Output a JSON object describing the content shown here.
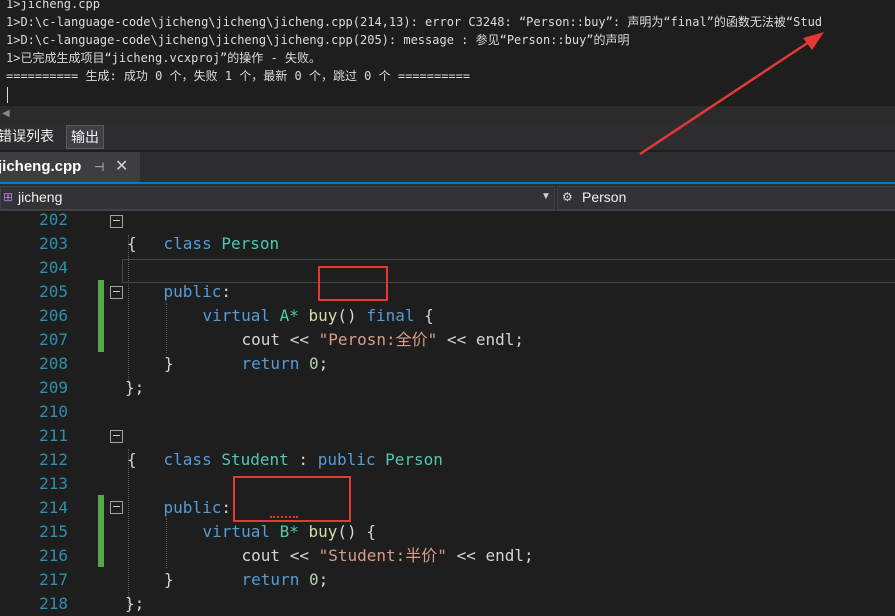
{
  "output": {
    "lines": [
      "1>jicheng.cpp",
      "1>D:\\c-language-code\\jicheng\\jicheng\\jicheng.cpp(214,13): error C3248: “Person::buy”: 声明为“final”的函数无法被“Stud",
      "1>D:\\c-language-code\\jicheng\\jicheng\\jicheng.cpp(205): message : 参见“Person::buy”的声明",
      "1>已完成生成项目“jicheng.vcxproj”的操作 - 失败。",
      "========== 生成: 成功 0 个，失败 1 个，最新 0 个，跳过 0 个 =========="
    ]
  },
  "panel_tabs": {
    "errors": "错误列表",
    "output": "输出"
  },
  "document_tab": {
    "label": "jicheng.cpp",
    "pin_icon": "pin-icon",
    "close_icon": "close-icon"
  },
  "navbar": {
    "project": "jicheng",
    "class": "Person"
  },
  "editor": {
    "line_numbers": [
      "202",
      "203",
      "204",
      "205",
      "206",
      "207",
      "208",
      "209",
      "210",
      "211",
      "212",
      "213",
      "214",
      "215",
      "216",
      "217",
      "218"
    ],
    "lines": {
      "l202_kw": "class",
      "l202_ty": "Person",
      "l203": "{",
      "l204_kw": "public",
      "l204_p": ":",
      "l205_kw": "virtual",
      "l205_t": "A*",
      "l205_fn": "buy",
      "l205_par": "()",
      "l205_fin": "final",
      "l205_br": "{",
      "l206_p1": "cout << ",
      "l206_str": "\"Perosn:全价\"",
      "l206_p2": " << endl;",
      "l207_kw": "return",
      "l207_num": "0",
      "l207_p": ";",
      "l208": "}",
      "l209": "};",
      "l211_kw": "class",
      "l211_ty": "Student",
      "l211_p": " : ",
      "l211_kw2": "public",
      "l211_ty2": "Person",
      "l212": "{",
      "l213_kw": "public",
      "l213_p": ":",
      "l214_kw": "virtual",
      "l214_t": "B*",
      "l214_fn": "buy",
      "l214_par": "()",
      "l214_br": "{",
      "l215_p1": "cout << ",
      "l215_str": "\"Student:半价\"",
      "l215_p2": " << endl;",
      "l216_kw": "return",
      "l216_num": "0",
      "l216_p": ";",
      "l217": "}",
      "l218": "};"
    }
  },
  "colors": {
    "accent": "#007acc",
    "annotation_red": "#e53935",
    "keyword": "#569cd6",
    "type": "#4ec9b0",
    "string": "#d69d85",
    "line_number": "#2b91af"
  }
}
